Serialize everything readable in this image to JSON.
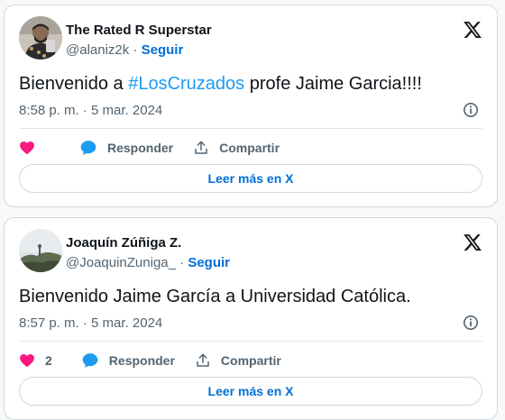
{
  "colors": {
    "accent": "#1d9bf0",
    "link": "#006fd6",
    "like": "#f91880",
    "text": "#0f1419",
    "muted": "#536471"
  },
  "tweets": [
    {
      "author_name": "The Rated R Superstar",
      "handle": "@alaniz2k",
      "separator": " · ",
      "follow_label": "Seguir",
      "text_before": "Bienvenido a ",
      "hashtag": "#LosCruzados",
      "text_after": " profe Jaime Garcia!!!!",
      "timestamp": "8:58 p. m. · 5 mar. 2024",
      "like_count": "",
      "reply_label": "Responder",
      "share_label": "Compartir",
      "read_more_label": "Leer más en X"
    },
    {
      "author_name": "Joaquín Zúñiga Z.",
      "handle": "@JoaquinZuniga_",
      "separator": " · ",
      "follow_label": "Seguir",
      "text": "Bienvenido Jaime García a Universidad Católica.",
      "timestamp": "8:57 p. m. · 5 mar. 2024",
      "like_count": "2",
      "reply_label": "Responder",
      "share_label": "Compartir",
      "read_more_label": "Leer más en X"
    }
  ],
  "icons": [
    "avatar-photo",
    "x-logo-icon",
    "info-icon",
    "heart-icon",
    "reply-bubble-icon",
    "share-icon"
  ]
}
